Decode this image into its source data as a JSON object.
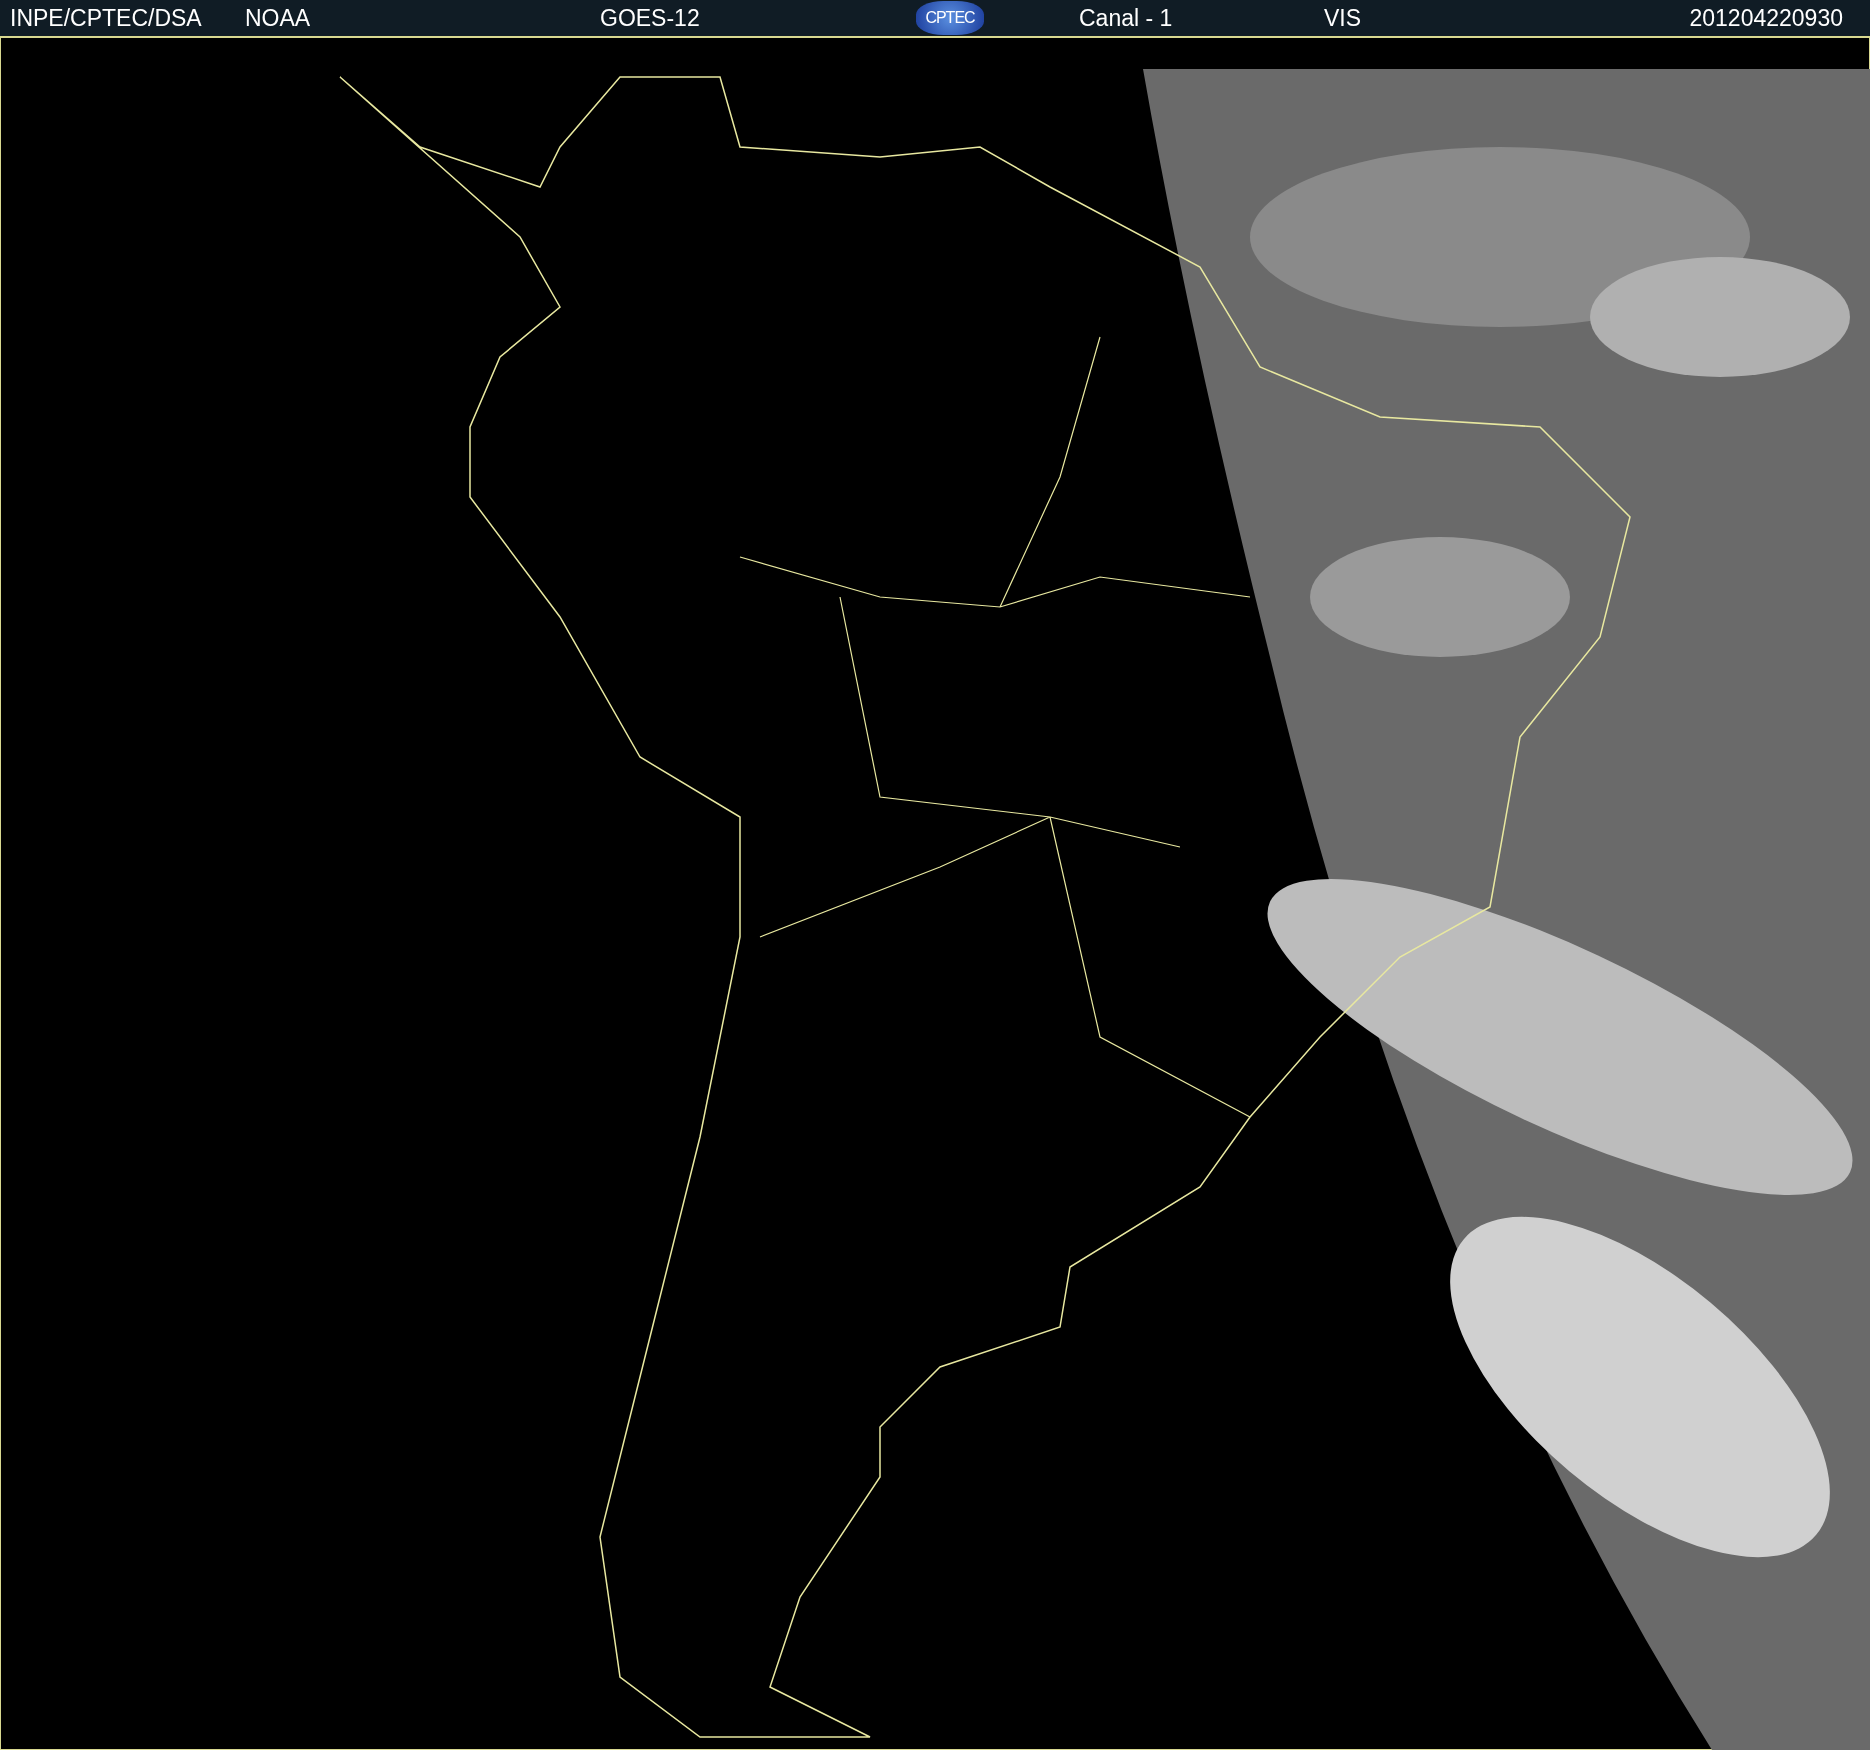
{
  "header": {
    "source": "INPE/CPTEC/DSA",
    "agency": "NOAA",
    "satellite": "GOES-12",
    "logo": "CPTEC",
    "channel": "Canal - 1",
    "band": "VIS",
    "timestamp": "201204220930"
  }
}
